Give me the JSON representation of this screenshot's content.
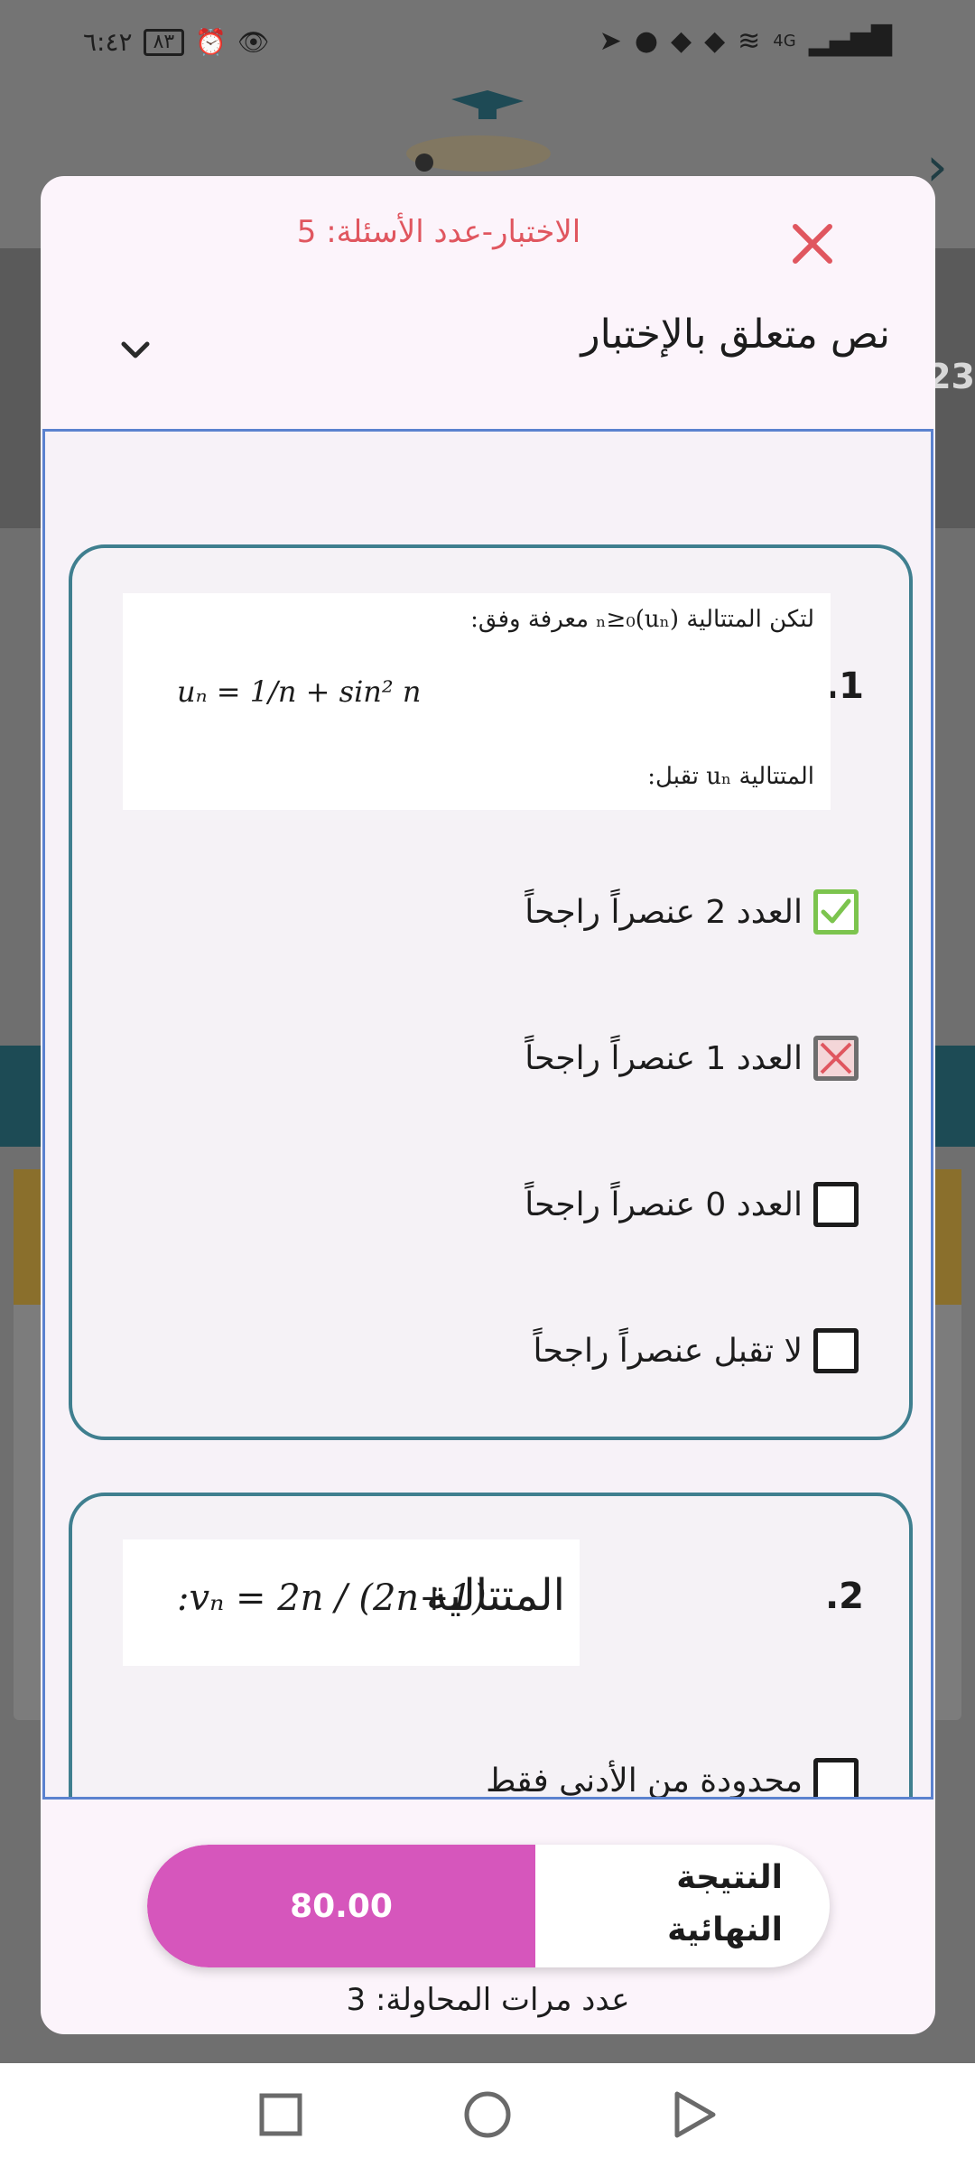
{
  "status_bar": {
    "time": "٦:٤٢",
    "battery": "٨٣",
    "network": "4G"
  },
  "background": {
    "partial_text": "23"
  },
  "modal": {
    "title": "الاختبار-عدد الأسئلة: 5",
    "subtitle": "نص متعلق بالإختبار"
  },
  "questions": [
    {
      "number": ".1",
      "image_text": {
        "line1": "لتكن المتتالية (uₙ)ₙ≥₀ معرفة وفق:",
        "formula": "uₙ = 1/n + sin² n",
        "line3": "المتتالية uₙ تقبل:"
      },
      "options": [
        {
          "label": "العدد 2 عنصراً راجحاً",
          "state": "correct"
        },
        {
          "label": "العدد 1 عنصراً راجحاً",
          "state": "wrong"
        },
        {
          "label": "العدد 0 عنصراً راجحاً",
          "state": "empty"
        },
        {
          "label": "لا تقبل عنصراً راجحاً",
          "state": "empty"
        }
      ]
    },
    {
      "number": ".2",
      "image_text": {
        "word": "المتتالية",
        "formula": ":vₙ = 2n / (2n+1)"
      },
      "options": [
        {
          "label": "محدودة من الأدنى فقط",
          "state": "empty"
        }
      ]
    }
  ],
  "result": {
    "label": "النتيجة النهائية",
    "score": "80.00"
  },
  "attempts": "عدد مرات المحاولة: 3",
  "colors": {
    "accent_red": "#e0565f",
    "score_fill": "#d656bc",
    "card_border": "#3f7f8f",
    "scroll_border": "#5b82cf",
    "correct_green": "#7cc44e"
  }
}
